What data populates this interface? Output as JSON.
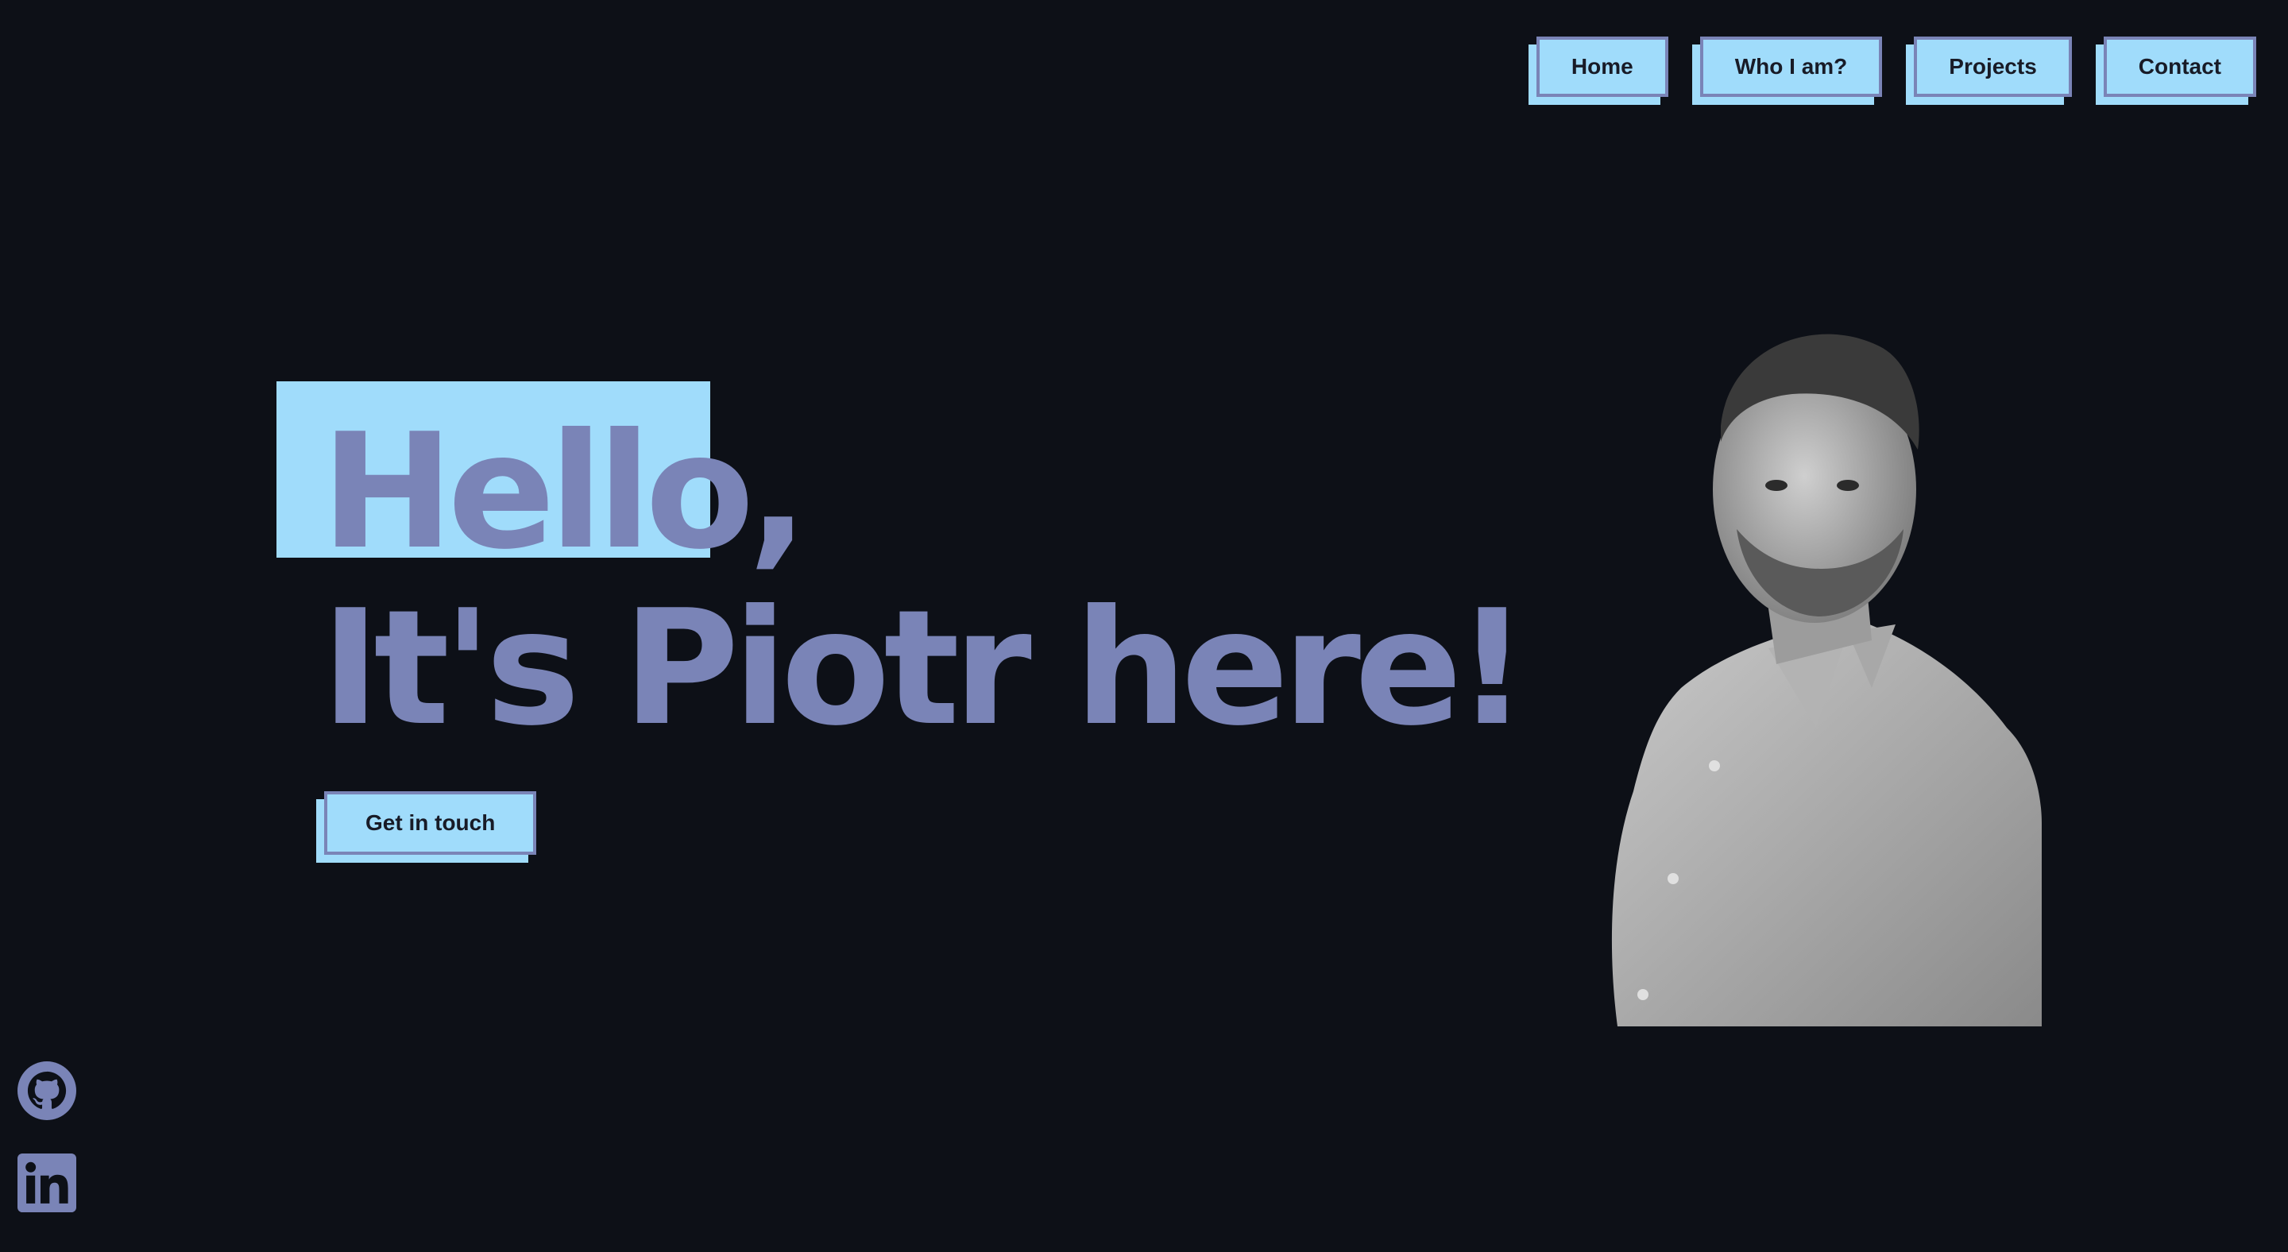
{
  "nav": {
    "items": [
      {
        "label": "Home"
      },
      {
        "label": "Who I am?"
      },
      {
        "label": "Projects"
      },
      {
        "label": "Contact"
      }
    ]
  },
  "hero": {
    "greeting": "Hello",
    "greeting_punct": ",",
    "intro": "It's Piotr here!",
    "cta_label": "Get in touch"
  },
  "social": {
    "github_icon": "github-icon",
    "linkedin_icon": "linkedin-icon"
  },
  "colors": {
    "background": "#0d1017",
    "accent_light": "#a0dcfb",
    "accent_text": "#7a84b7",
    "button_text": "#181b27"
  }
}
